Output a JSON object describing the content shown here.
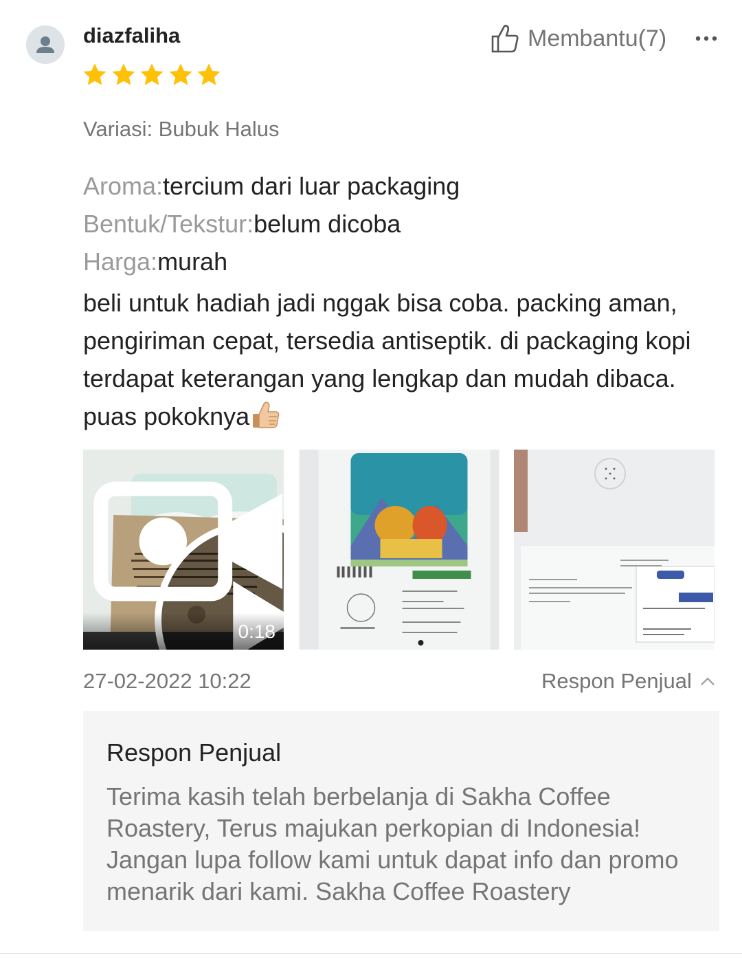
{
  "review": {
    "username": "diazfaliha",
    "rating": 5,
    "helpful_label": "Membantu(7)",
    "variant": "Variasi: Bubuk Halus",
    "attributes": [
      {
        "label": "Aroma:",
        "value": "tercium dari luar packaging"
      },
      {
        "label": "Bentuk/Tekstur:",
        "value": "belum dicoba"
      },
      {
        "label": "Harga:",
        "value": "murah"
      }
    ],
    "text": "beli untuk hadiah jadi nggak bisa coba. packing aman, pengiriman cepat, tersedia antiseptik. di packaging kopi terdapat keterangan yang lengkap dan mudah dibaca. puas pokoknya",
    "media": [
      {
        "type": "video",
        "duration": "0:18"
      },
      {
        "type": "image"
      },
      {
        "type": "image"
      }
    ],
    "timestamp": "27-02-2022 10:22",
    "seller_response_toggle": "Respon Penjual"
  },
  "seller_response": {
    "title": "Respon Penjual",
    "text": "Terima kasih telah berbelanja di Sakha Coffee Roastery, Terus majukan perkopian di Indonesia! Jangan lupa follow kami untuk dapat info dan promo menarik dari kami. Sakha Coffee Roastery"
  },
  "colors": {
    "star": "#FFC107",
    "muted_text": "#757575",
    "response_bg": "#F5F5F5"
  },
  "icons": [
    "user-avatar-icon",
    "thumbs-up-icon",
    "more-options-icon",
    "star-icon",
    "play-icon",
    "video-camera-icon",
    "chevron-up-icon",
    "thumbs-up-emoji"
  ]
}
